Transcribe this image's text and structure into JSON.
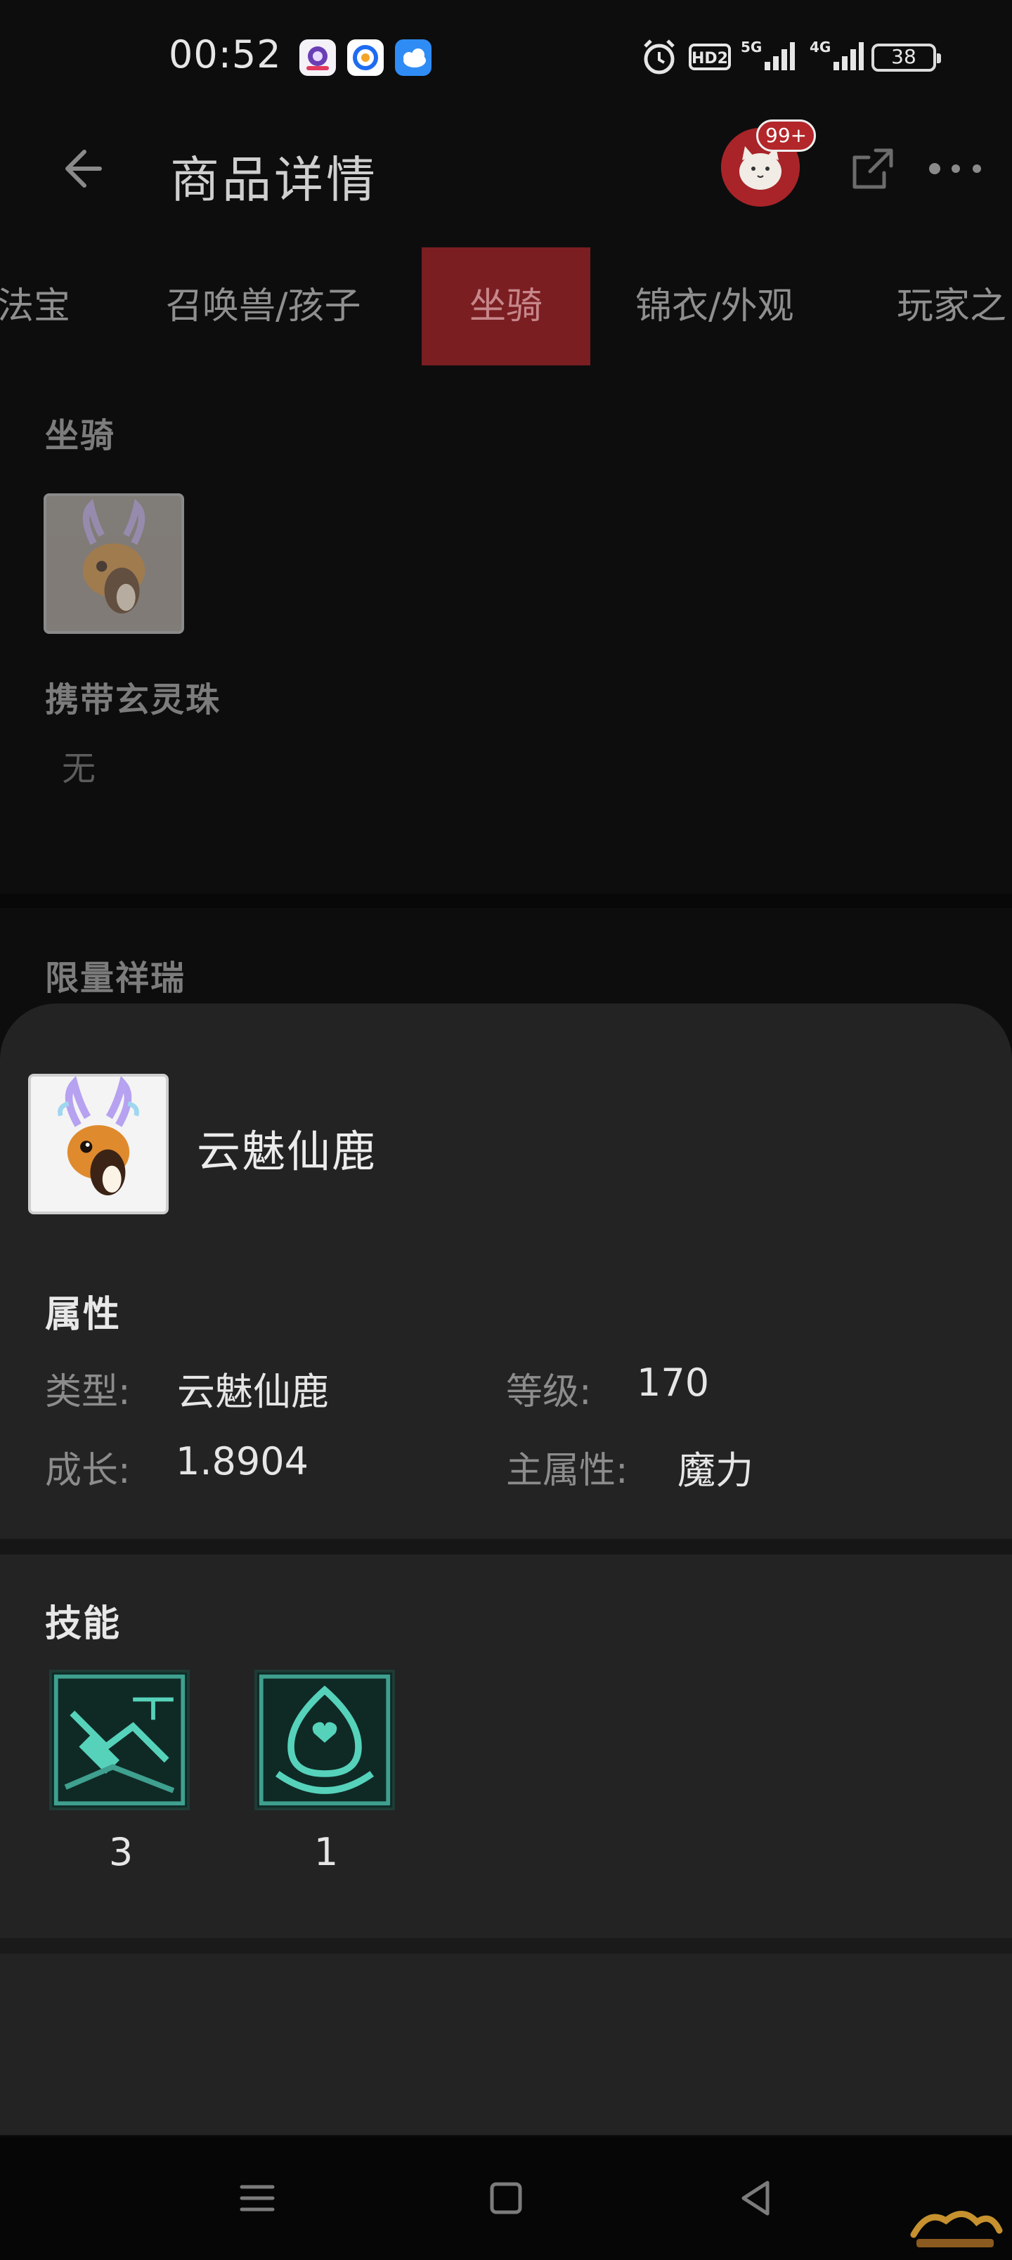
{
  "status_bar": {
    "time": "00:52",
    "battery": "38",
    "network_labels": [
      "HD2",
      "5G",
      "4G"
    ],
    "icons": [
      "app-notification-1-icon",
      "app-notification-2-icon",
      "weather-app-icon",
      "alarm-icon",
      "hd-voice-icon",
      "signal-5g-icon",
      "signal-4g-icon",
      "battery-icon"
    ]
  },
  "header": {
    "title": "商品详情",
    "badge": "99+",
    "icons": [
      "back-arrow-icon",
      "cat-avatar-icon",
      "share-icon",
      "more-dots-icon"
    ]
  },
  "tabs": [
    {
      "label": "法宝"
    },
    {
      "label": "召唤兽/孩子"
    },
    {
      "label": "坐骑",
      "active": true
    },
    {
      "label": "锦衣/外观"
    },
    {
      "label": "玩家之"
    }
  ],
  "content": {
    "mount_section_title": "坐骑",
    "carry_title": "携带玄灵珠",
    "carry_value": "无",
    "limited_title": "限量祥瑞"
  },
  "sheet": {
    "name": "云魅仙鹿",
    "attributes_heading": "属性",
    "attributes": {
      "type_label": "类型:",
      "type_value": "云魅仙鹿",
      "level_label": "等级:",
      "level_value": "170",
      "growth_label": "成长:",
      "growth_value": "1.8904",
      "main_attr_label": "主属性:",
      "main_attr_value": "魔力"
    },
    "skills_heading": "技能",
    "skills": [
      {
        "level": "3",
        "icon": "skill-shovel-icon"
      },
      {
        "level": "1",
        "icon": "skill-heart-shield-icon"
      }
    ]
  },
  "nav_bar": {
    "icons": [
      "menu-icon",
      "home-square-icon",
      "back-triangle-icon"
    ]
  },
  "colors": {
    "background": "#0d0d0e",
    "sheet": "#232324",
    "accent_tab": "#7a1e22",
    "badge": "#b3262a"
  }
}
